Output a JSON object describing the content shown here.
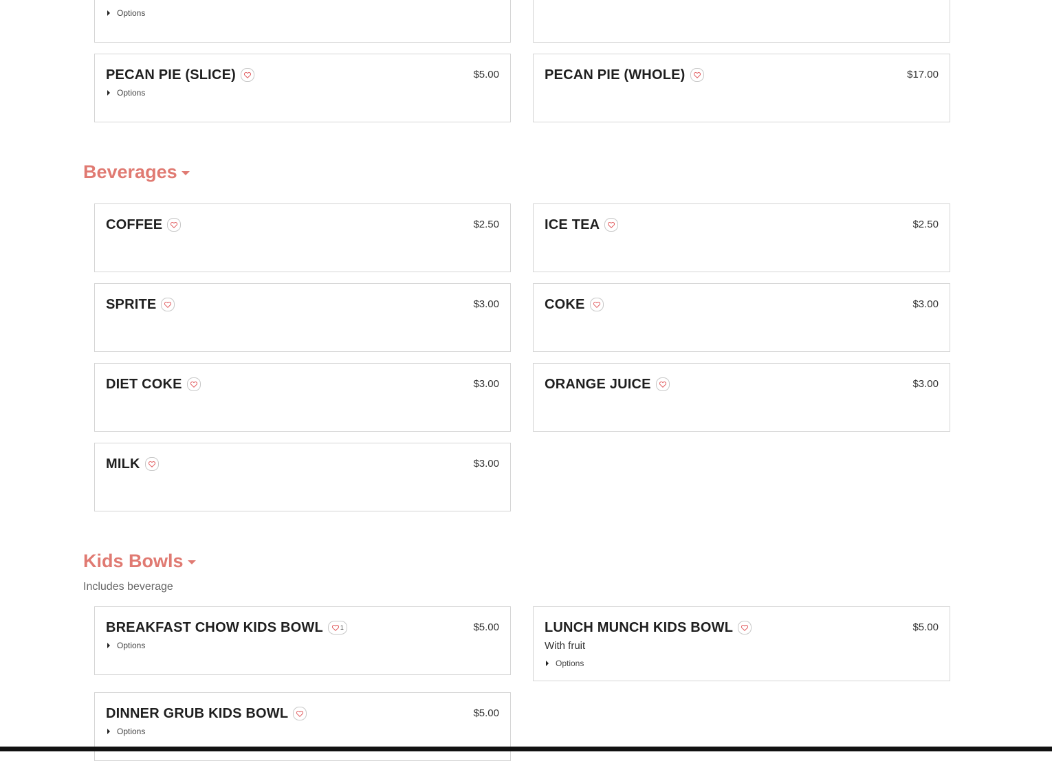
{
  "colors": {
    "accent": "#e07a72",
    "border": "#d4d4d4",
    "bottom_bar": "#111111"
  },
  "top_partial": {
    "left": {
      "options_label": "Options"
    }
  },
  "desserts": [
    {
      "name": "PECAN PIE (SLICE)",
      "price": "$5.00",
      "options_label": "Options"
    },
    {
      "name": "PECAN PIE (WHOLE)",
      "price": "$17.00"
    }
  ],
  "beverages": {
    "title": "Beverages",
    "items": [
      {
        "name": "COFFEE",
        "price": "$2.50"
      },
      {
        "name": "ICE TEA",
        "price": "$2.50"
      },
      {
        "name": "SPRITE",
        "price": "$3.00"
      },
      {
        "name": "COKE",
        "price": "$3.00"
      },
      {
        "name": "DIET COKE",
        "price": "$3.00"
      },
      {
        "name": "ORANGE JUICE",
        "price": "$3.00"
      },
      {
        "name": "MILK",
        "price": "$3.00"
      }
    ]
  },
  "kids_bowls": {
    "title": "Kids Bowls",
    "subtitle": "Includes beverage",
    "items": [
      {
        "name": "BREAKFAST CHOW KIDS BOWL",
        "price": "$5.00",
        "favorite_count": "1",
        "options_label": "Options"
      },
      {
        "name": "LUNCH MUNCH KIDS BOWL",
        "price": "$5.00",
        "description": "With fruit",
        "options_label": "Options"
      },
      {
        "name": "DINNER GRUB KIDS BOWL",
        "price": "$5.00",
        "options_label": "Options"
      }
    ]
  },
  "icons": {
    "favorite": "heart-outline-icon",
    "expand": "caret-right-icon",
    "collapse": "caret-down-icon"
  }
}
